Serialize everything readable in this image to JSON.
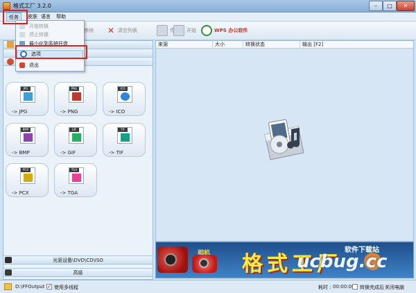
{
  "window": {
    "title": "格式工厂 3.2.0",
    "min": "–",
    "max": "□",
    "close": "✕"
  },
  "menu": {
    "task": "任务",
    "skin": "皮肤",
    "language": "语言",
    "help": "帮助"
  },
  "toolbar": {
    "remove": "移除",
    "clear": "清空列表",
    "stop": "停止",
    "start": "开始",
    "wps": "WPS 办公软件"
  },
  "dropdown": {
    "start": "开始转换",
    "stop": "停止转换",
    "tray": "最小化到系统托盘",
    "options": "选项",
    "exit": "退出"
  },
  "categories": {
    "rom": "光驱设备\\DVD\\CD\\ISO",
    "advanced": "高级"
  },
  "formats": [
    {
      "tag": "JPG",
      "label": "-> JPG",
      "color": "#3aa0d8"
    },
    {
      "tag": "PNG",
      "label": "-> PNG",
      "color": "#c0392b"
    },
    {
      "tag": "ICO",
      "label": "-> ICO",
      "color": "#2e86de"
    },
    {
      "tag": "BMP",
      "label": "-> BMP",
      "color": "#8e44ad"
    },
    {
      "tag": "GIF",
      "label": "-> GIF",
      "color": "#27ae60"
    },
    {
      "tag": "TIF",
      "label": "-> TIF",
      "color": "#16a085"
    },
    {
      "tag": "PCX",
      "label": "-> PCX",
      "color": "#d4ac0d"
    },
    {
      "tag": "TGA",
      "label": "-> TGA",
      "color": "#e84393"
    }
  ],
  "list": {
    "source": "来源",
    "size": "大小",
    "status": "转换状态",
    "output": "输出 [F2]"
  },
  "banner": {
    "camera_label": "相机",
    "text": "格式工厂"
  },
  "watermark": {
    "brand": "ucbug.cc",
    "cn": "软件下载站"
  },
  "status": {
    "path": "D:\\FFOutput",
    "multithread": "使用多线程",
    "multithread_checked": true,
    "elapsed_label": "耗时 :",
    "elapsed": "00:00:00",
    "after_done": "转换完成后 :",
    "shutdown": "关闭电脑"
  }
}
